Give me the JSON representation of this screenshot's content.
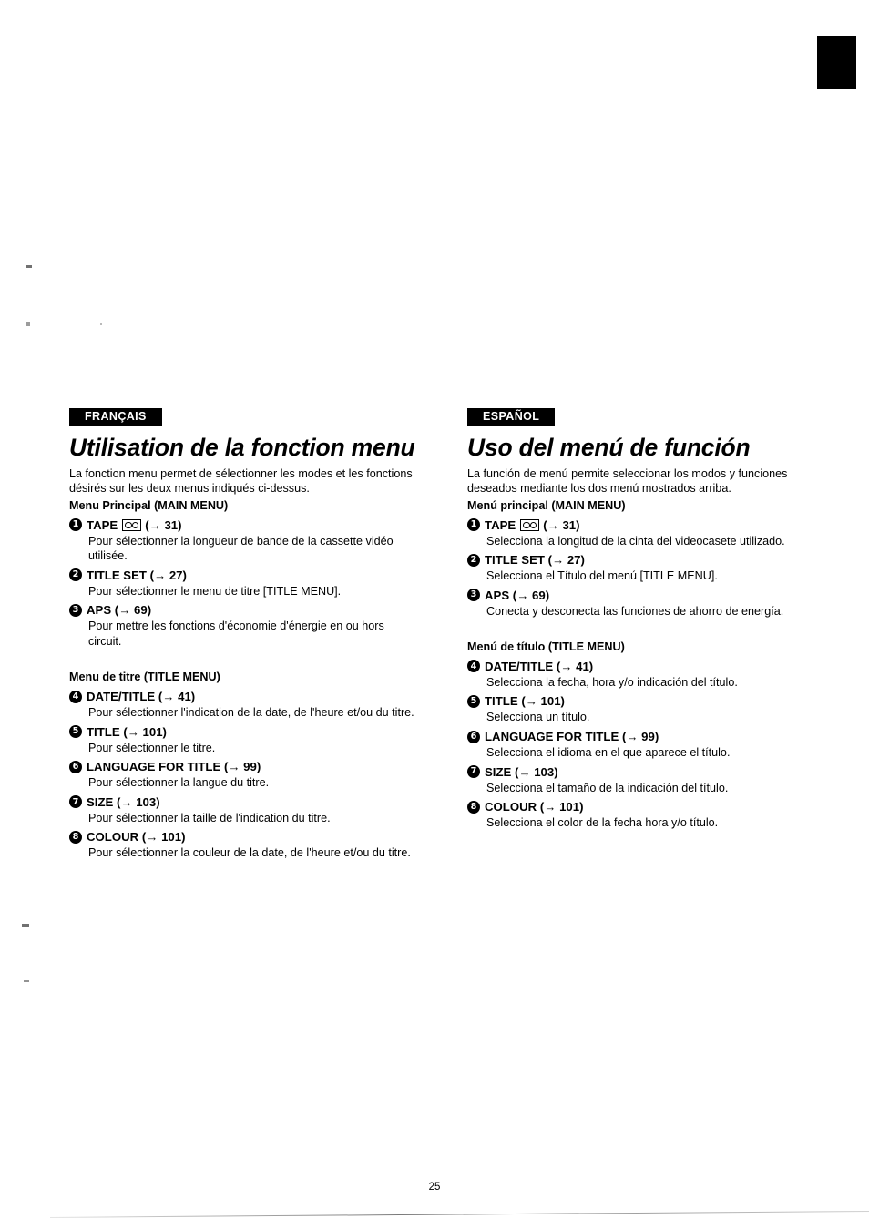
{
  "page": {
    "number": "25",
    "thumb_tab": "black-index-tab"
  },
  "columns": [
    {
      "language_badge": "FRANÇAIS",
      "title": "Utilisation de la fonction menu",
      "intro": "La fonction menu permet de sélectionner les modes et les fonctions désirés sur les deux menus indiqués ci-dessus.",
      "groups": [
        {
          "heading": "Menu Principal (MAIN MENU)",
          "items": [
            {
              "number": "1",
              "label": "TAPE",
              "icon": "cassette-tape-icon",
              "ref": "(→ 31)",
              "desc": "Pour sélectionner la longueur de bande de la cassette vidéo utilisée."
            },
            {
              "number": "2",
              "label": "TITLE SET",
              "icon": null,
              "ref": "(→ 27)",
              "desc": "Pour sélectionner le menu de titre [TITLE MENU]."
            },
            {
              "number": "3",
              "label": "APS",
              "icon": null,
              "ref": "(→ 69)",
              "desc": "Pour mettre les fonctions d'économie d'énergie en ou hors circuit."
            }
          ]
        },
        {
          "heading": "Menu de titre (TITLE MENU)",
          "items": [
            {
              "number": "4",
              "label": "DATE/TITLE",
              "icon": null,
              "ref": "(→ 41)",
              "desc": "Pour sélectionner l'indication de la date, de l'heure et/ou du titre."
            },
            {
              "number": "5",
              "label": "TITLE",
              "icon": null,
              "ref": "(→ 101)",
              "desc": "Pour sélectionner le titre."
            },
            {
              "number": "6",
              "label": "LANGUAGE FOR TITLE",
              "icon": null,
              "ref": "(→ 99)",
              "desc": "Pour sélectionner la langue du titre."
            },
            {
              "number": "7",
              "label": "SIZE",
              "icon": null,
              "ref": "(→ 103)",
              "desc": "Pour sélectionner la taille de l'indication du titre."
            },
            {
              "number": "8",
              "label": "COLOUR",
              "icon": null,
              "ref": "(→ 101)",
              "desc": "Pour sélectionner la couleur de la date, de l'heure et/ou du titre."
            }
          ]
        }
      ]
    },
    {
      "language_badge": "ESPAÑOL",
      "title": "Uso del menú de función",
      "intro": "La función de menú permite seleccionar los modos y funciones deseados mediante los dos menú mostrados arriba.",
      "groups": [
        {
          "heading": "Menú principal (MAIN MENU)",
          "items": [
            {
              "number": "1",
              "label": "TAPE",
              "icon": "cassette-tape-icon",
              "ref": "(→ 31)",
              "desc": "Selecciona la longitud de la cinta del videocasete utilizado."
            },
            {
              "number": "2",
              "label": "TITLE SET",
              "icon": null,
              "ref": "(→ 27)",
              "desc": "Selecciona el Título del menú [TITLE MENU]."
            },
            {
              "number": "3",
              "label": "APS",
              "icon": null,
              "ref": "(→ 69)",
              "desc": "Conecta y desconecta las funciones de ahorro de energía."
            }
          ]
        },
        {
          "heading": "Menú de título (TITLE MENU)",
          "items": [
            {
              "number": "4",
              "label": "DATE/TITLE",
              "icon": null,
              "ref": "(→ 41)",
              "desc": "Selecciona la fecha, hora y/o indicación del título."
            },
            {
              "number": "5",
              "label": "TITLE",
              "icon": null,
              "ref": "(→ 101)",
              "desc": "Selecciona un título."
            },
            {
              "number": "6",
              "label": "LANGUAGE FOR TITLE",
              "icon": null,
              "ref": "(→ 99)",
              "desc": "Selecciona el idioma en el que aparece el título."
            },
            {
              "number": "7",
              "label": "SIZE",
              "icon": null,
              "ref": "(→ 103)",
              "desc": "Selecciona el tamaño de la indicación del título."
            },
            {
              "number": "8",
              "label": "COLOUR",
              "icon": null,
              "ref": "(→ 101)",
              "desc": "Selecciona el color de la fecha hora y/o título."
            }
          ]
        }
      ]
    }
  ]
}
